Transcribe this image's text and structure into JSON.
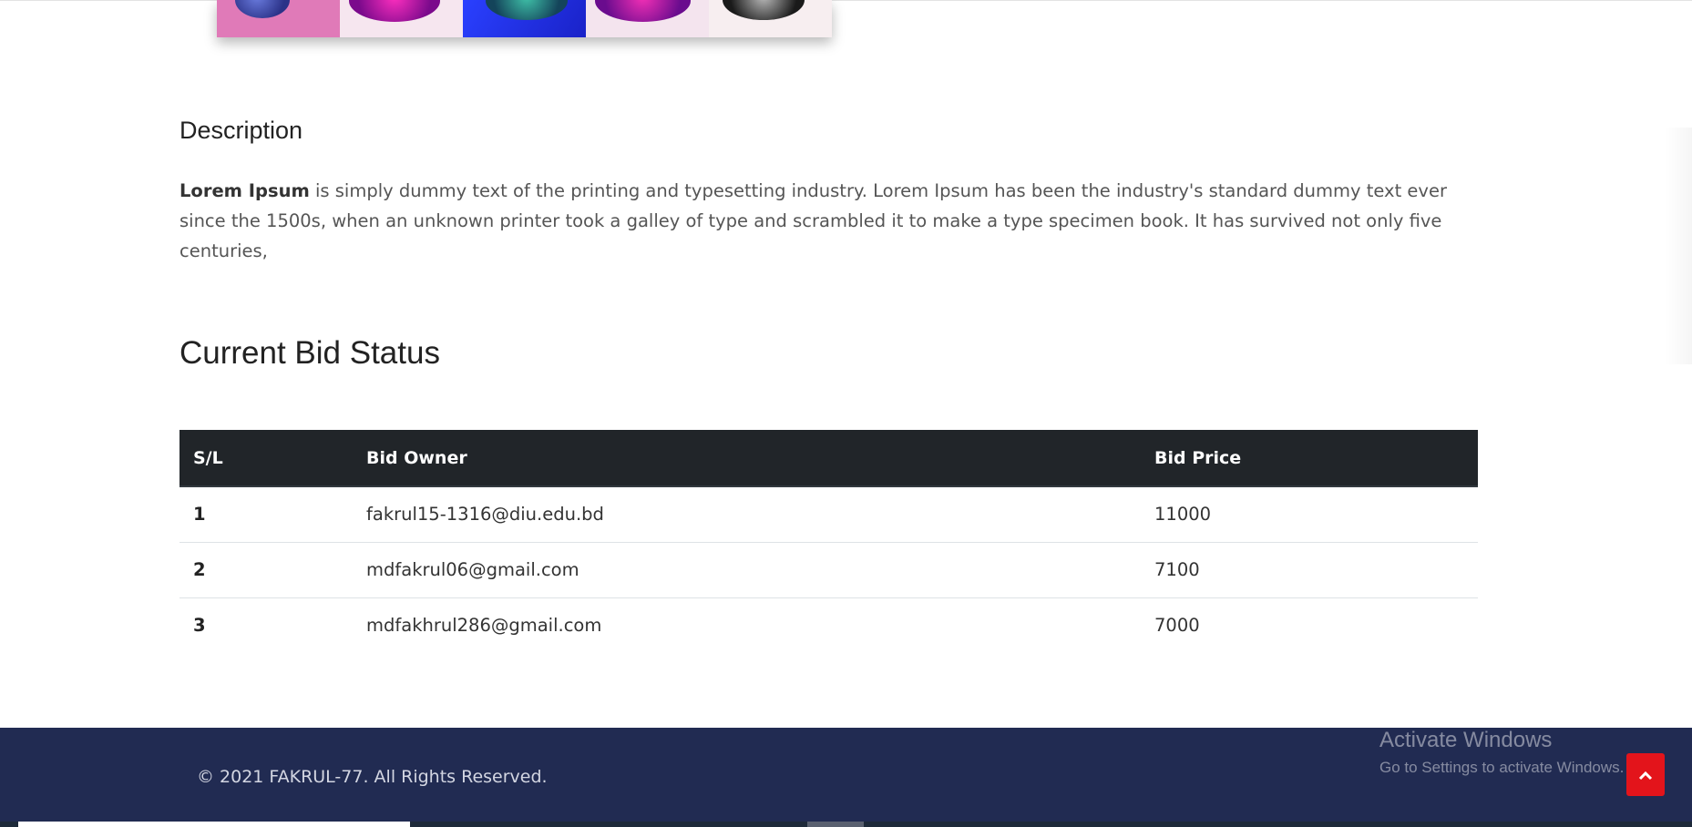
{
  "gallery": {
    "thumbnails": [
      {
        "name": "headphones-pink",
        "bg": "#e07ab8"
      },
      {
        "name": "headphones-magenta",
        "bg": "#f6e6ef"
      },
      {
        "name": "headphones-teal",
        "bg": "#1c2ee6"
      },
      {
        "name": "headphones-purple",
        "bg": "#f4e4ee"
      },
      {
        "name": "headphones-black",
        "bg": "#f7eef0"
      }
    ]
  },
  "description": {
    "heading": "Description",
    "lead_bold": "Lorem Ipsum",
    "text": " is simply dummy text of the printing and typesetting industry. Lorem Ipsum has been the industry's standard dummy text ever since the 1500s, when an unknown printer took a galley of type and scrambled it to make a type specimen book. It has survived not only five centuries,"
  },
  "bids": {
    "heading": "Current Bid Status",
    "columns": [
      "S/L",
      "Bid Owner",
      "Bid Price"
    ],
    "rows": [
      {
        "sl": "1",
        "owner": "fakrul15-1316@diu.edu.bd",
        "price": "11000"
      },
      {
        "sl": "2",
        "owner": "mdfakrul06@gmail.com",
        "price": "7100"
      },
      {
        "sl": "3",
        "owner": "mdfakhrul286@gmail.com",
        "price": "7000"
      }
    ]
  },
  "footer": {
    "copyright": "© 2021 FAKRUL-77. All Rights Reserved.",
    "scroll_top_icon": "chevron-up-icon",
    "bg_color": "#212b52",
    "button_color": "#e3141b"
  },
  "watermark": {
    "line1": "Activate Windows",
    "line2": "Go to Settings to activate Windows."
  }
}
